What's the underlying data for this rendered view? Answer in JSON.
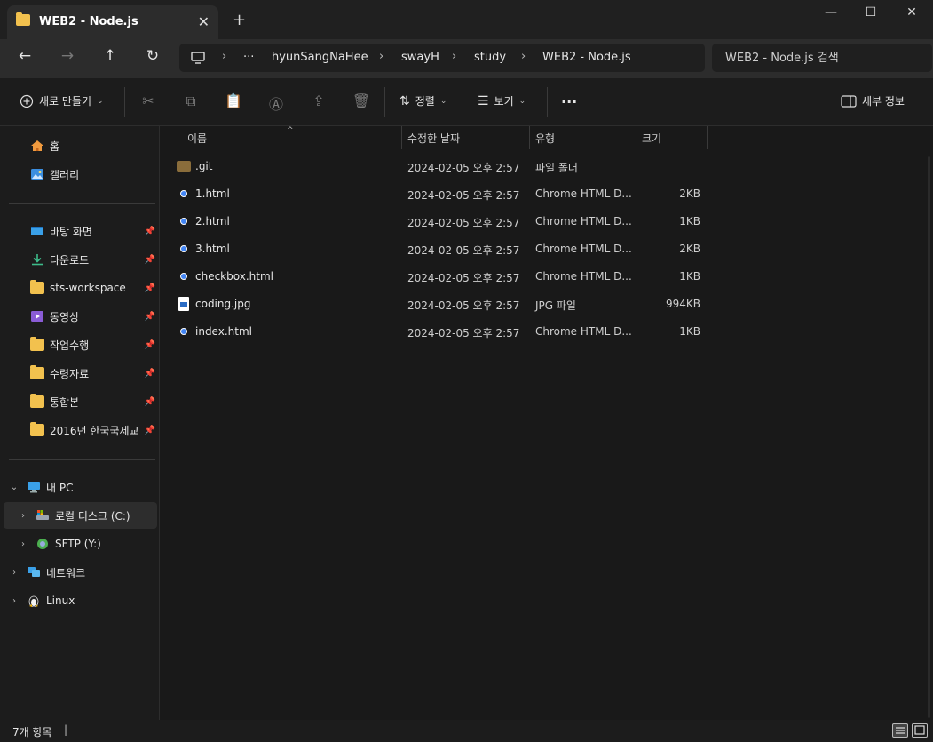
{
  "window": {
    "tab_title": "WEB2 - Node.js",
    "tab_close": "✕",
    "new_tab": "+",
    "minimize": "—",
    "maximize": "☐",
    "close": "✕"
  },
  "nav": {
    "back": "←",
    "forward": "→",
    "up": "↑",
    "refresh": "↻",
    "breadcrumb": [
      "···",
      "hyunSangNaHee",
      "swayH",
      "study",
      "WEB2 - Node.js"
    ],
    "search_placeholder": "WEB2 - Node.js 검색"
  },
  "toolbar": {
    "new_label": "새로 만들기",
    "sort_label": "정렬",
    "view_label": "보기",
    "more_label": "···",
    "details_label": "세부 정보"
  },
  "sidebar": {
    "top": [
      {
        "label": "홈",
        "icon": "home-icon"
      },
      {
        "label": "갤러리",
        "icon": "gallery-icon"
      }
    ],
    "pinned": [
      {
        "label": "바탕 화면",
        "icon": "desktop-icon"
      },
      {
        "label": "다운로드",
        "icon": "download-icon"
      },
      {
        "label": "sts-workspace",
        "icon": "folder-icon"
      },
      {
        "label": "동영상",
        "icon": "video-icon"
      },
      {
        "label": "작업수행",
        "icon": "folder-icon"
      },
      {
        "label": "수령자료",
        "icon": "folder-icon"
      },
      {
        "label": "통합본",
        "icon": "folder-icon"
      },
      {
        "label": "2016년 한국국제교",
        "icon": "folder-icon"
      }
    ],
    "devices": [
      {
        "label": "내 PC",
        "icon": "pc-icon",
        "expand": "⌄",
        "indent": 0
      },
      {
        "label": "로컬 디스크 (C:)",
        "icon": "drive-icon",
        "expand": "›",
        "indent": 1
      },
      {
        "label": "SFTP (Y:)",
        "icon": "sftp-icon",
        "expand": "›",
        "indent": 1
      },
      {
        "label": "네트워크",
        "icon": "network-icon",
        "expand": "›",
        "indent": 0
      },
      {
        "label": "Linux",
        "icon": "linux-icon",
        "expand": "›",
        "indent": 0
      }
    ]
  },
  "columns": {
    "name": "이름",
    "date": "수정한 날짜",
    "type": "유형",
    "size": "크기"
  },
  "files": [
    {
      "name": ".git",
      "date": "2024-02-05 오후 2:57",
      "type": "파일 폴더",
      "size": "",
      "icon": "git-folder-icon"
    },
    {
      "name": "1.html",
      "date": "2024-02-05 오후 2:57",
      "type": "Chrome HTML D...",
      "size": "2KB",
      "icon": "chrome-icon"
    },
    {
      "name": "2.html",
      "date": "2024-02-05 오후 2:57",
      "type": "Chrome HTML D...",
      "size": "1KB",
      "icon": "chrome-icon"
    },
    {
      "name": "3.html",
      "date": "2024-02-05 오후 2:57",
      "type": "Chrome HTML D...",
      "size": "2KB",
      "icon": "chrome-icon"
    },
    {
      "name": "checkbox.html",
      "date": "2024-02-05 오후 2:57",
      "type": "Chrome HTML D...",
      "size": "1KB",
      "icon": "chrome-icon"
    },
    {
      "name": "coding.jpg",
      "date": "2024-02-05 오후 2:57",
      "type": "JPG 파일",
      "size": "994KB",
      "icon": "jpg-icon"
    },
    {
      "name": "index.html",
      "date": "2024-02-05 오후 2:57",
      "type": "Chrome HTML D...",
      "size": "1KB",
      "icon": "chrome-icon"
    }
  ],
  "status": {
    "item_count": "7개 항목"
  }
}
